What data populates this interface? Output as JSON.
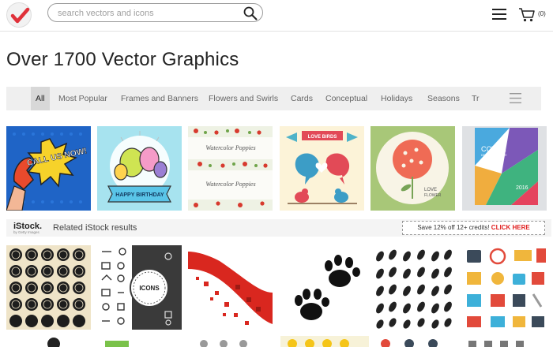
{
  "header": {
    "search_placeholder": "search vectors and icons",
    "cart_count": "(0)",
    "brand_color": "#e0313a"
  },
  "page_title": "Over 1700 Vector Graphics",
  "categories": [
    {
      "label": "All",
      "active": true
    },
    {
      "label": "Most Popular"
    },
    {
      "label": "Frames and Banners"
    },
    {
      "label": "Flowers and Swirls"
    },
    {
      "label": "Cards"
    },
    {
      "label": "Conceptual"
    },
    {
      "label": "Holidays"
    },
    {
      "label": "Seasons"
    },
    {
      "label": "Tr"
    }
  ],
  "thumbnails": {
    "call_us_now": "CALL US NOW!",
    "birthday": "HAPPY BIRTHDAY",
    "watercolor_1": "Watercolor Poppies",
    "watercolor_2": "Watercolor Poppies",
    "love_birds": "LOVE BIRDS",
    "love_flower_1": "LOVE",
    "love_flower_2": "FLOWER",
    "cover_title": "COVER",
    "cover_sub": "DESIGN TEMPLATE",
    "cover_year": "2016"
  },
  "istock": {
    "logo": "iStock.",
    "logo_sub": "by Getty Images",
    "related": "Related iStock results",
    "promo_text": "Save 12% off 12+ credits!",
    "promo_link": "CLICK HERE"
  },
  "stock_thumbs": {
    "icons_label": "ICONS"
  }
}
